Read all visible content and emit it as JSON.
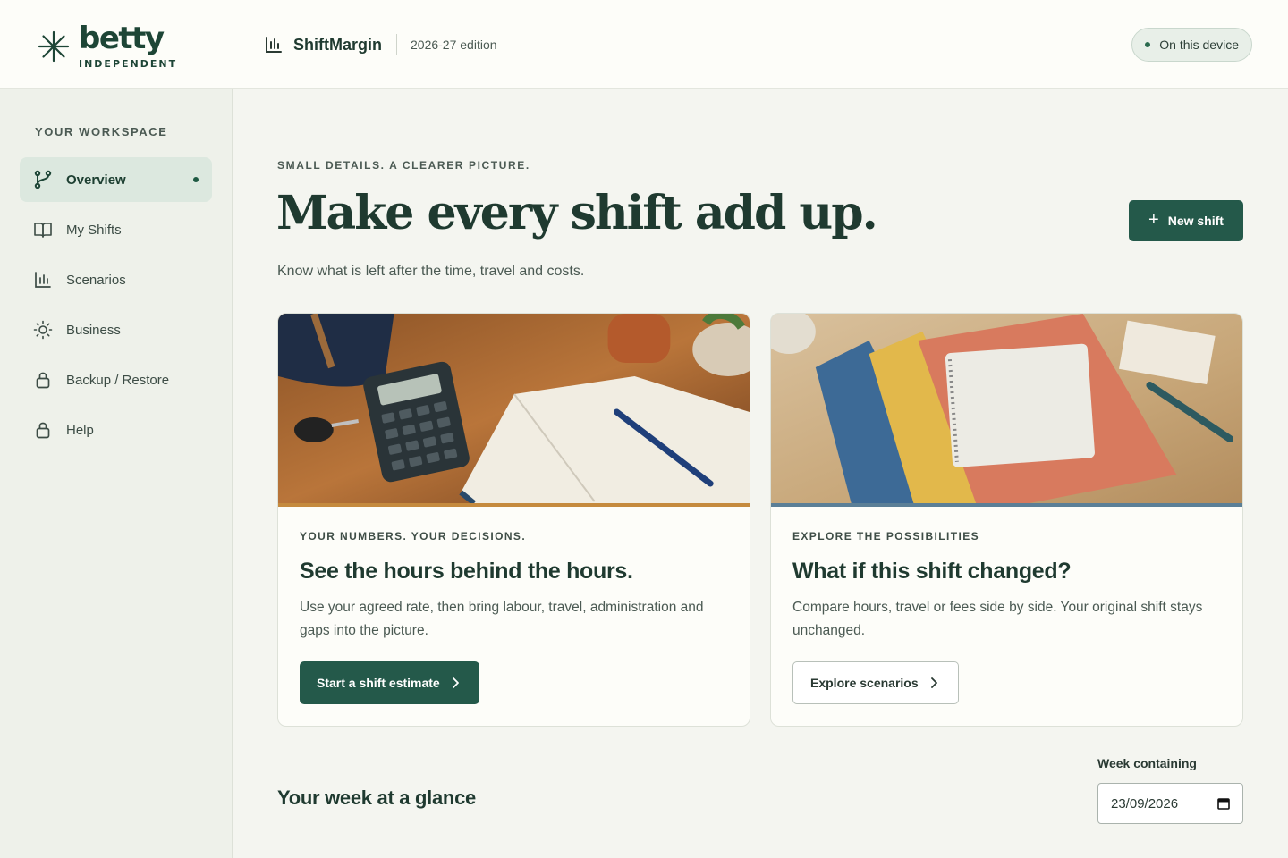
{
  "brand": {
    "name": "betty",
    "sub": "INDEPENDENT",
    "color": "#1d4536"
  },
  "app": {
    "name": "ShiftMargin",
    "edition": "2026-27 edition"
  },
  "status": {
    "label": "On this device"
  },
  "sidebar": {
    "heading": "YOUR WORKSPACE",
    "items": [
      {
        "label": "Overview",
        "icon": "branch-icon",
        "active": true
      },
      {
        "label": "My Shifts",
        "icon": "book-icon"
      },
      {
        "label": "Scenarios",
        "icon": "bar-chart-icon"
      },
      {
        "label": "Business",
        "icon": "sun-icon"
      },
      {
        "label": "Backup / Restore",
        "icon": "lock-icon"
      },
      {
        "label": "Help",
        "icon": "lock-icon"
      }
    ]
  },
  "hero": {
    "eyebrow": "SMALL DETAILS. A CLEARER PICTURE.",
    "title": "Make every shift add up.",
    "subtitle": "Know what is left after the time, travel and costs.",
    "new_shift_label": "New shift"
  },
  "cards": [
    {
      "eyebrow": "YOUR NUMBERS. YOUR DECISIONS.",
      "title": "See the hours behind the hours.",
      "text": "Use your agreed rate, then bring labour, travel, administration and gaps into the picture.",
      "button": "Start a shift estimate",
      "band_color": "#c58a3e"
    },
    {
      "eyebrow": "EXPLORE THE POSSIBILITIES",
      "title": "What if this shift changed?",
      "text": "Compare hours, travel or fees side by side. Your original shift stays unchanged.",
      "button": "Explore scenarios",
      "band_color": "#5b7f97"
    }
  ],
  "week": {
    "title": "Your week at a glance",
    "label": "Week containing",
    "date": "23/09/2026"
  },
  "colors": {
    "accent": "#24594a",
    "background": "#f4f5f0",
    "sidebar": "#eef1ea"
  }
}
